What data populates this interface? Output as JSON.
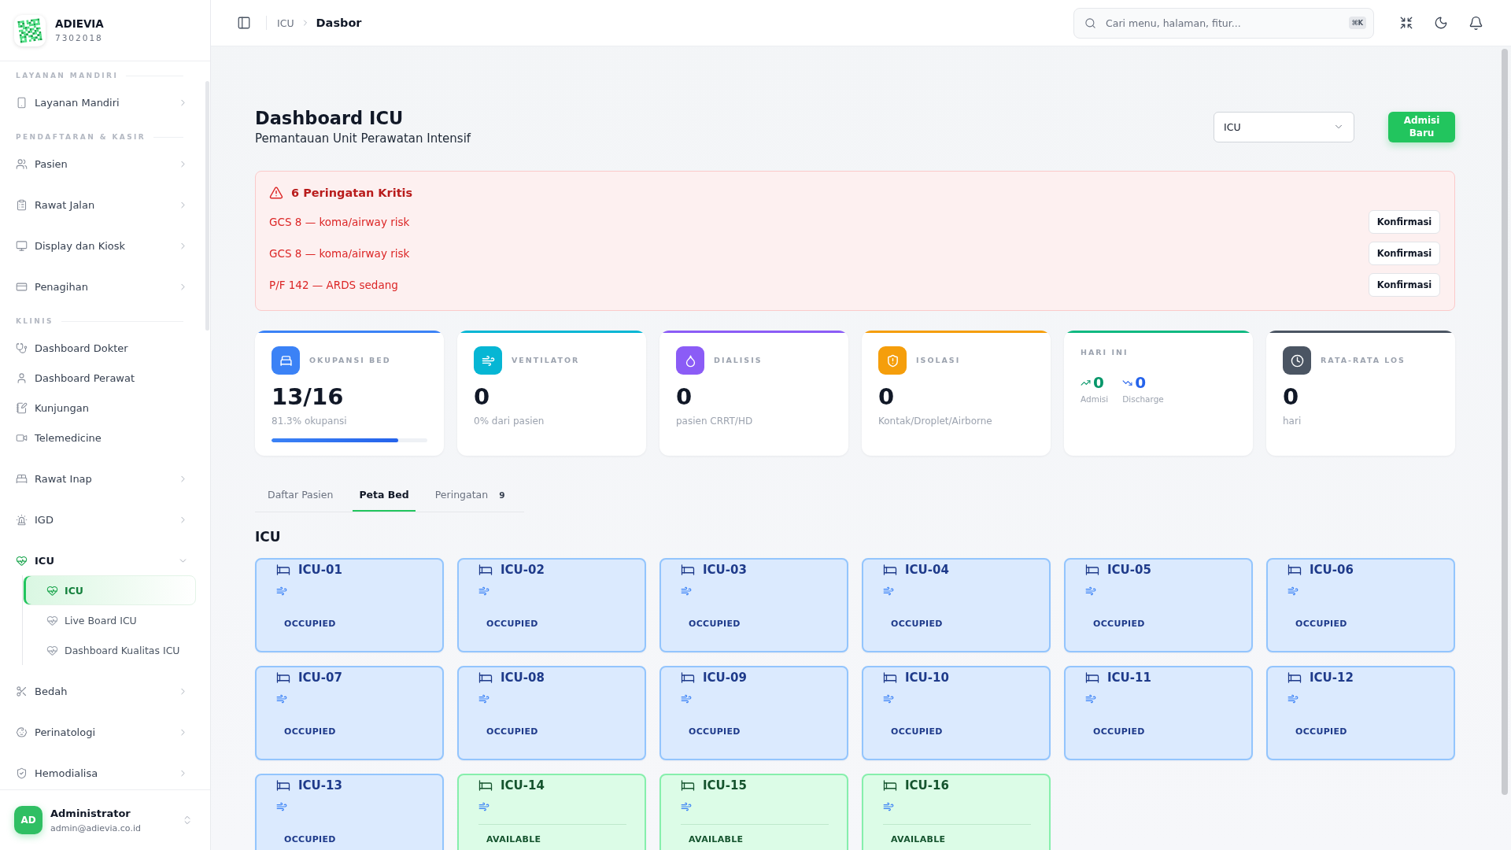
{
  "sidebar": {
    "brand": {
      "name": "ADIEVIA",
      "code": "7302018"
    },
    "sections": [
      {
        "title": "LAYANAN MANDIRI",
        "items": [
          {
            "label": "Layanan Mandiri",
            "kind": "group",
            "expanded": false
          }
        ]
      },
      {
        "title": "PENDAFTARAN & KASIR",
        "items": [
          {
            "label": "Pasien",
            "kind": "group",
            "expanded": false
          },
          {
            "label": "Rawat Jalan",
            "kind": "group",
            "expanded": false
          },
          {
            "label": "Display dan Kiosk",
            "kind": "group",
            "expanded": false
          },
          {
            "label": "Penagihan",
            "kind": "group",
            "expanded": false
          }
        ]
      },
      {
        "title": "KLINIS",
        "items": [
          {
            "label": "Dashboard Dokter",
            "kind": "link"
          },
          {
            "label": "Dashboard Perawat",
            "kind": "link"
          },
          {
            "label": "Kunjungan",
            "kind": "link"
          },
          {
            "label": "Telemedicine",
            "kind": "link"
          },
          {
            "label": "Rawat Inap",
            "kind": "group",
            "expanded": false
          },
          {
            "label": "IGD",
            "kind": "group",
            "expanded": false
          },
          {
            "label": "ICU",
            "kind": "group",
            "expanded": true,
            "children": [
              {
                "label": "ICU",
                "selected": true
              },
              {
                "label": "Live Board ICU",
                "selected": false
              },
              {
                "label": "Dashboard Kualitas ICU",
                "selected": false
              }
            ]
          },
          {
            "label": "Bedah",
            "kind": "group",
            "expanded": false
          },
          {
            "label": "Perinatologi",
            "kind": "group",
            "expanded": false
          },
          {
            "label": "Hemodialisa",
            "kind": "group",
            "expanded": false
          }
        ]
      }
    ],
    "user": {
      "initials": "AD",
      "name": "Administrator",
      "email": "admin@adievia.co.id"
    }
  },
  "topbar": {
    "breadcrumb": [
      {
        "label": "ICU"
      },
      {
        "label": "Dasbor"
      }
    ],
    "search": {
      "placeholder": "Cari menu, halaman, fitur...",
      "shortcut": "⌘K"
    }
  },
  "page_header": {
    "title": "Dashboard ICU",
    "subtitle": "Pemantauan Unit Perawatan Intensif",
    "unit_select": {
      "value": "ICU"
    },
    "primary_button": {
      "label": "Admisi Baru"
    }
  },
  "alerts": {
    "title": "6 Peringatan Kritis",
    "items": [
      {
        "message": "GCS 8 — koma/airway risk",
        "action": "Konfirmasi"
      },
      {
        "message": "GCS 8 — koma/airway risk",
        "action": "Konfirmasi"
      },
      {
        "message": "P/F 142 — ARDS sedang",
        "action": "Konfirmasi"
      }
    ]
  },
  "stats": [
    {
      "kind": "metric",
      "label": "OKUPANSI BED",
      "value": "13/16",
      "note": "81.3% okupansi",
      "level": 0.813,
      "color": "#3b82f6"
    },
    {
      "kind": "metric",
      "label": "VENTILATOR",
      "value": "0",
      "note": "0% dari pasien",
      "color": "#06b6d4"
    },
    {
      "kind": "metric",
      "label": "DIALISIS",
      "value": "0",
      "note": "pasien CRRT/HD",
      "color": "#8b5cf6"
    },
    {
      "kind": "metric",
      "label": "ISOLASI",
      "value": "0",
      "note": "Kontak/Droplet/Airborne",
      "color": "#f59e0b"
    },
    {
      "kind": "flow",
      "label": "HARI INI",
      "color": "#10b981",
      "entries": [
        {
          "kind": "up",
          "value": "0",
          "label": "Admisi"
        },
        {
          "kind": "down",
          "value": "0",
          "label": "Discharge"
        }
      ]
    },
    {
      "kind": "metric",
      "label": "RATA-RATA LOS",
      "value": "0",
      "note": "hari",
      "color": "#4b5563"
    }
  ],
  "tabs": [
    {
      "label": "Daftar Pasien",
      "selected": false
    },
    {
      "label": "Peta Bed",
      "selected": true
    },
    {
      "label": "Peringatan",
      "selected": false,
      "count": "9"
    }
  ],
  "bed_map": {
    "title": "ICU",
    "beds": [
      {
        "name": "ICU-01",
        "status": "OCCUPIED",
        "kind": "occupied"
      },
      {
        "name": "ICU-02",
        "status": "OCCUPIED",
        "kind": "occupied"
      },
      {
        "name": "ICU-03",
        "status": "OCCUPIED",
        "kind": "occupied"
      },
      {
        "name": "ICU-04",
        "status": "OCCUPIED",
        "kind": "occupied"
      },
      {
        "name": "ICU-05",
        "status": "OCCUPIED",
        "kind": "occupied"
      },
      {
        "name": "ICU-06",
        "status": "OCCUPIED",
        "kind": "occupied"
      },
      {
        "name": "ICU-07",
        "status": "OCCUPIED",
        "kind": "occupied"
      },
      {
        "name": "ICU-08",
        "status": "OCCUPIED",
        "kind": "occupied"
      },
      {
        "name": "ICU-09",
        "status": "OCCUPIED",
        "kind": "occupied"
      },
      {
        "name": "ICU-10",
        "status": "OCCUPIED",
        "kind": "occupied"
      },
      {
        "name": "ICU-11",
        "status": "OCCUPIED",
        "kind": "occupied"
      },
      {
        "name": "ICU-12",
        "status": "OCCUPIED",
        "kind": "occupied"
      },
      {
        "name": "ICU-13",
        "status": "OCCUPIED",
        "kind": "occupied"
      },
      {
        "name": "ICU-14",
        "status": "AVAILABLE",
        "kind": "available"
      },
      {
        "name": "ICU-15",
        "status": "AVAILABLE",
        "kind": "available"
      },
      {
        "name": "ICU-16",
        "status": "AVAILABLE",
        "kind": "available"
      }
    ]
  }
}
